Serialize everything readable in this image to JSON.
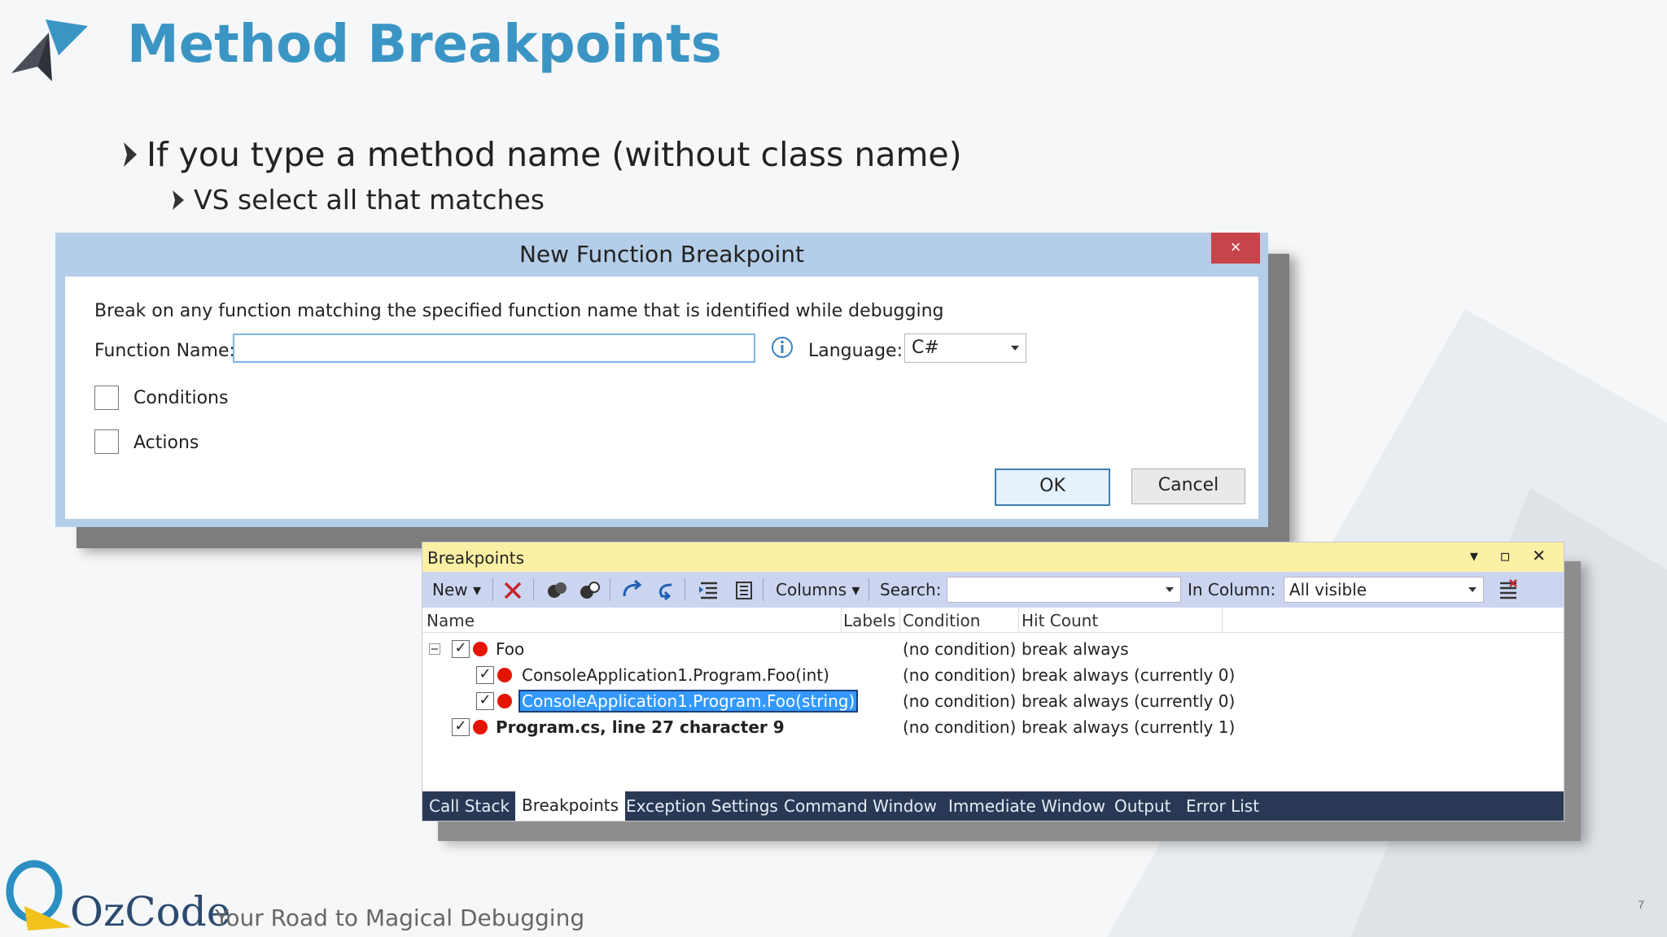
{
  "slide": {
    "title": "Method Breakpoints",
    "bullet1": "If you type a method name (without class name)",
    "bullet2": "VS select all that matches",
    "page_number": "7"
  },
  "dialog": {
    "title": "New Function Breakpoint",
    "close_glyph": "×",
    "description": "Break on any function matching the specified function name that is identified while debugging",
    "function_name_label": "Function Name:",
    "function_name_value": "",
    "language_label": "Language:",
    "language_value": "C#",
    "conditions_label": "Conditions",
    "actions_label": "Actions",
    "ok_label": "OK",
    "cancel_label": "Cancel"
  },
  "breakpoints": {
    "title": "Breakpoints",
    "window_controls": "▾ ▫ ✕",
    "toolbar": {
      "new_label": "New",
      "columns_label": "Columns",
      "search_label": "Search:",
      "search_value": "",
      "in_column_label": "In Column:",
      "in_column_value": "All visible"
    },
    "columns": [
      "Name",
      "Labels",
      "Condition",
      "Hit Count"
    ],
    "rows": [
      {
        "name": "Foo",
        "condition": "(no condition)",
        "hit_count": "break always"
      },
      {
        "name": "ConsoleApplication1.Program.Foo(int)",
        "condition": "(no condition)",
        "hit_count": "break always (currently 0)"
      },
      {
        "name": "ConsoleApplication1.Program.Foo(string)",
        "condition": "(no condition)",
        "hit_count": "break always (currently 0)"
      },
      {
        "name": "Program.cs, line 27 character 9",
        "condition": "(no condition)",
        "hit_count": "break always (currently 1)"
      }
    ],
    "tabs": [
      "Call Stack",
      "Breakpoints",
      "Exception Settings",
      "Command Window",
      "Immediate Window",
      "Output",
      "Error List"
    ]
  },
  "footer": {
    "brand": "OzCode",
    "tagline": "Your Road to Magical Debugging"
  },
  "colors": {
    "title_blue": "#3b95c4",
    "breakpoint_red": "#e51400",
    "selection_blue": "#3399ff",
    "tab_bar": "#293955"
  }
}
